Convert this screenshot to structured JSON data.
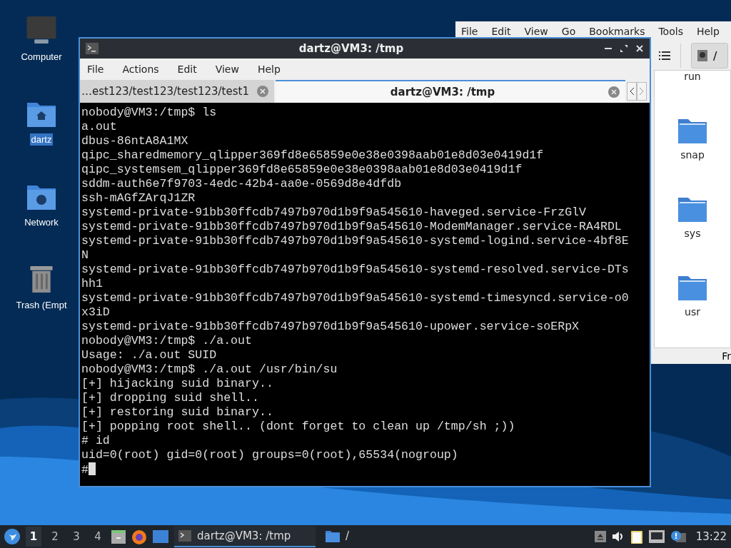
{
  "desktop_icons": [
    {
      "label": "Computer",
      "kind": "computer",
      "selected": false
    },
    {
      "label": "dartz",
      "kind": "home",
      "selected": true
    },
    {
      "label": "Network",
      "kind": "network",
      "selected": false
    },
    {
      "label": "Trash (Empt",
      "kind": "trash",
      "selected": false
    }
  ],
  "file_manager": {
    "menu": [
      "File",
      "Edit",
      "View",
      "Go",
      "Bookmarks",
      "Tools",
      "Help"
    ],
    "path_button": "/",
    "items": [
      "run",
      "snap",
      "sys",
      "usr"
    ],
    "status": "Fr"
  },
  "terminal": {
    "title": "dartz@VM3: /tmp",
    "menu": [
      "File",
      "Actions",
      "Edit",
      "View",
      "Help"
    ],
    "tabs": [
      {
        "label": "…est123/test123/test123/test1",
        "selected": false
      },
      {
        "label": "dartz@VM3: /tmp",
        "selected": true
      }
    ],
    "lines": [
      "nobody@VM3:/tmp$ ls",
      "a.out",
      "dbus-86ntA8A1MX",
      "qipc_sharedmemory_qlipper369fd8e65859e0e38e0398aab01e8d03e0419d1f",
      "qipc_systemsem_qlipper369fd8e65859e0e38e0398aab01e8d03e0419d1f",
      "sddm-auth6e7f9703-4edc-42b4-aa0e-0569d8e4dfdb",
      "ssh-mAGfZArqJ1ZR",
      "systemd-private-91bb30ffcdb7497b970d1b9f9a545610-haveged.service-FrzGlV",
      "systemd-private-91bb30ffcdb7497b970d1b9f9a545610-ModemManager.service-RA4RDL",
      "systemd-private-91bb30ffcdb7497b970d1b9f9a545610-systemd-logind.service-4bf8E",
      "N",
      "systemd-private-91bb30ffcdb7497b970d1b9f9a545610-systemd-resolved.service-DTs",
      "hh1",
      "systemd-private-91bb30ffcdb7497b970d1b9f9a545610-systemd-timesyncd.service-o0",
      "x3iD",
      "systemd-private-91bb30ffcdb7497b970d1b9f9a545610-upower.service-soERpX",
      "nobody@VM3:/tmp$ ./a.out",
      "Usage: ./a.out SUID",
      "nobody@VM3:/tmp$ ./a.out /usr/bin/su",
      "[+] hijacking suid binary..",
      "[+] dropping suid shell..",
      "[+] restoring suid binary..",
      "[+] popping root shell.. (dont forget to clean up /tmp/sh ;))",
      "# id",
      "uid=0(root) gid=0(root) groups=0(root),65534(nogroup)",
      "#"
    ]
  },
  "taskbar": {
    "workspaces": [
      {
        "label": "1",
        "selected": true
      },
      {
        "label": "2",
        "selected": false
      },
      {
        "label": "3",
        "selected": false
      },
      {
        "label": "4",
        "selected": false
      }
    ],
    "tasks": [
      {
        "label": "dartz@VM3: /tmp",
        "kind": "terminal",
        "selected": true
      },
      {
        "label": "/",
        "kind": "folder",
        "selected": false
      }
    ],
    "clock": "13:22"
  }
}
